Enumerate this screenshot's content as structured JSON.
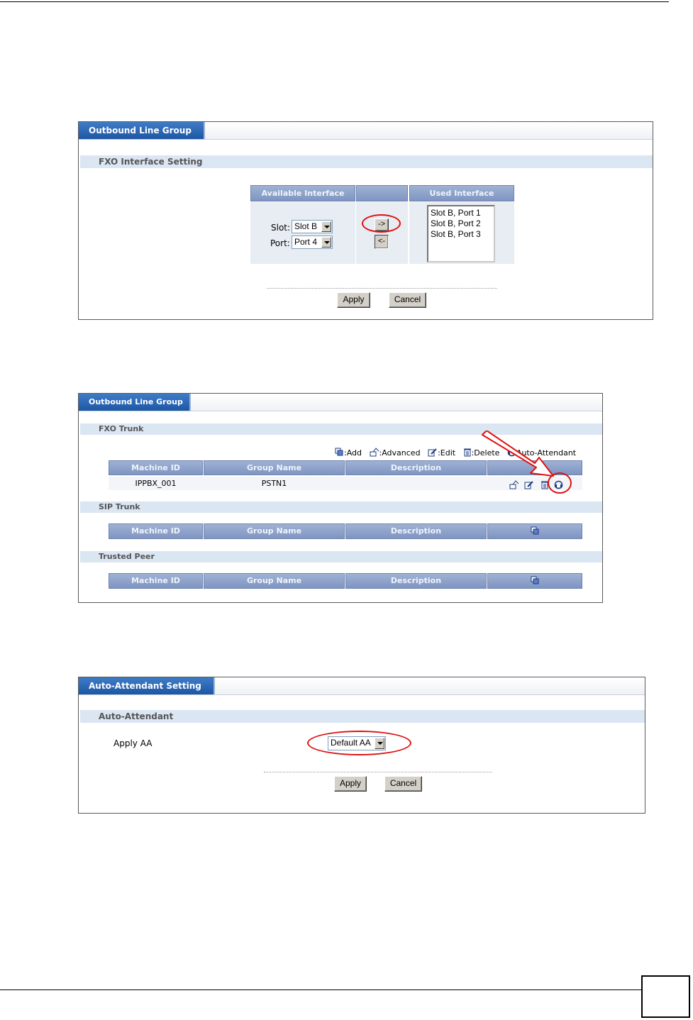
{
  "page": {
    "page_number": ""
  },
  "panel1": {
    "tab_label": "Outbound Line Group",
    "section_title": "FXO Interface Setting",
    "available_header": "Available Interface",
    "used_header": "Used Interface",
    "slot_label": "Slot:",
    "slot_value": "Slot B",
    "port_label": "Port:",
    "port_value": "Port 4",
    "add_arrow": "->",
    "remove_arrow": "<-",
    "used_items": [
      "Slot B, Port 1",
      "Slot B, Port 2",
      "Slot B, Port 3"
    ],
    "apply_label": "Apply",
    "cancel_label": "Cancel"
  },
  "panel2": {
    "tab_label": "Outbound Line Group",
    "fxo_section": "FXO Trunk",
    "sip_section": "SIP Trunk",
    "peer_section": "Trusted Peer",
    "legend": {
      "add": ":Add",
      "advanced": ":Advanced",
      "edit": ":Edit",
      "delete": ":Delete",
      "auto_attendant": "Auto-Attendant"
    },
    "columns": [
      "Machine ID",
      "Group Name",
      "Description"
    ],
    "fxo_rows": [
      {
        "machine_id": "IPPBX_001",
        "group_name": "PSTN1",
        "description": ""
      }
    ]
  },
  "panel3": {
    "tab_label": "Auto-Attendant Setting",
    "section_title": "Auto-Attendant",
    "apply_aa_label": "Apply AA",
    "aa_value": "Default AA",
    "apply_label": "Apply",
    "cancel_label": "Cancel"
  },
  "colors": {
    "tab_blue": "#2a66b4",
    "section_bg": "#dbe6f3",
    "header_blue": "#8fa3cc",
    "annotation_red": "#e01010"
  }
}
